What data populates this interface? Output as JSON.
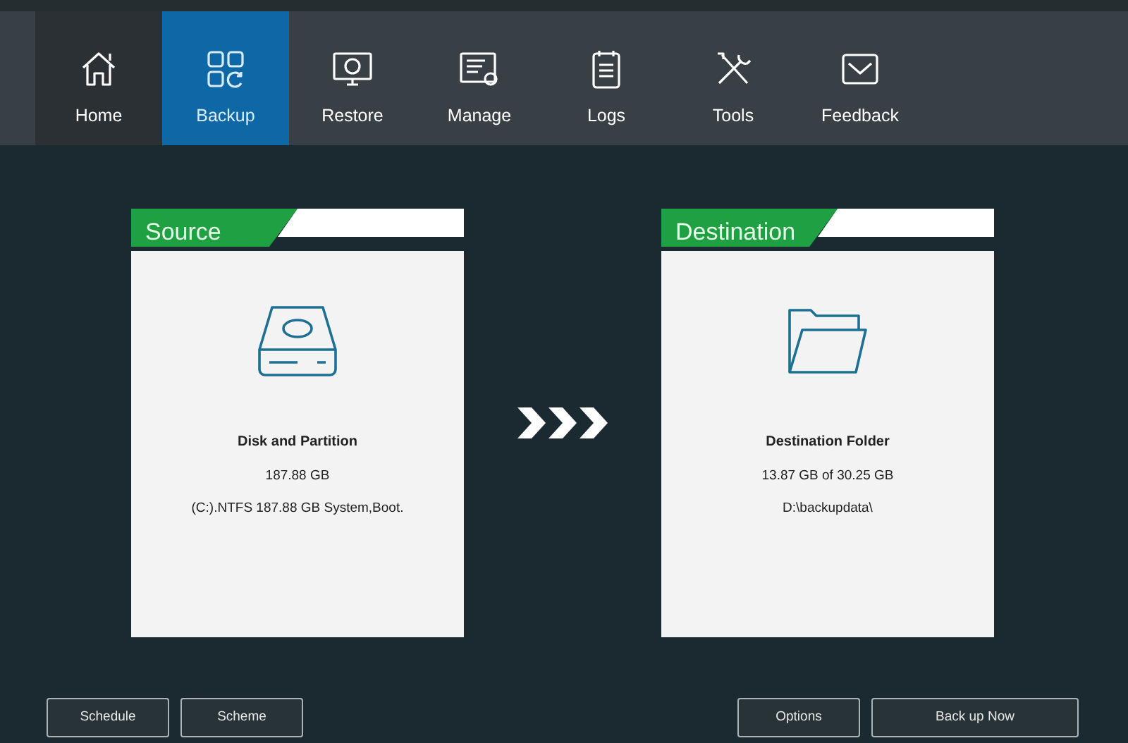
{
  "nav": [
    {
      "label": "Home",
      "selected": false,
      "highlighted": true
    },
    {
      "label": "Backup",
      "selected": true,
      "highlighted": false
    },
    {
      "label": "Restore",
      "selected": false,
      "highlighted": false
    },
    {
      "label": "Manage",
      "selected": false,
      "highlighted": false
    },
    {
      "label": "Logs",
      "selected": false,
      "highlighted": false
    },
    {
      "label": "Tools",
      "selected": false,
      "highlighted": false
    },
    {
      "label": "Feedback",
      "selected": false,
      "highlighted": false
    }
  ],
  "source": {
    "title": "Source",
    "name": "Disk and Partition",
    "lines": [
      "187.88 GB",
      "(C:).NTFS 187.88 GB System,Boot."
    ]
  },
  "destination": {
    "title": "Destination",
    "name": "Destination Folder",
    "lines": [
      "13.87 GB of 30.25 GB",
      "D:\\backupdata\\"
    ]
  },
  "left_buttons": [
    "Schedule",
    "Scheme"
  ],
  "right_buttons": [
    "Options",
    "Back up Now"
  ]
}
